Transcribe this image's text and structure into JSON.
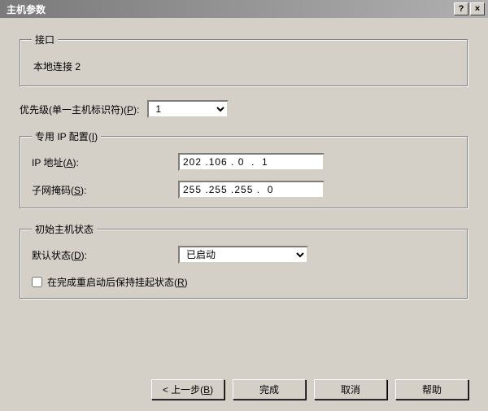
{
  "title": "主机参数",
  "interface_group": {
    "legend": "接口",
    "value": "本地连接 2"
  },
  "priority": {
    "label_pre": "优先级(单一主机标识符)(",
    "hotkey": "P",
    "label_post": "):",
    "value": "1"
  },
  "ip_group": {
    "legend_pre": "专用 IP 配置(",
    "legend_hotkey": "I",
    "legend_post": ")",
    "ip_label_pre": "IP 地址(",
    "ip_hotkey": "A",
    "ip_label_post": "):",
    "ip_value": "202 .106 . 0  .  1",
    "mask_label_pre": "子网掩码(",
    "mask_hotkey": "S",
    "mask_label_post": "):",
    "mask_value": "255 .255 .255 .  0"
  },
  "state_group": {
    "legend": "初始主机状态",
    "default_label_pre": "默认状态(",
    "default_hotkey": "D",
    "default_label_post": "):",
    "default_value": "已启动",
    "checkbox_label_pre": "在完成重启动后保持挂起状态(",
    "checkbox_hotkey": "R",
    "checkbox_label_post": ")"
  },
  "buttons": {
    "back_pre": "< 上一步(",
    "back_hotkey": "B",
    "back_post": ")",
    "finish": "完成",
    "cancel": "取消",
    "help": "帮助"
  }
}
